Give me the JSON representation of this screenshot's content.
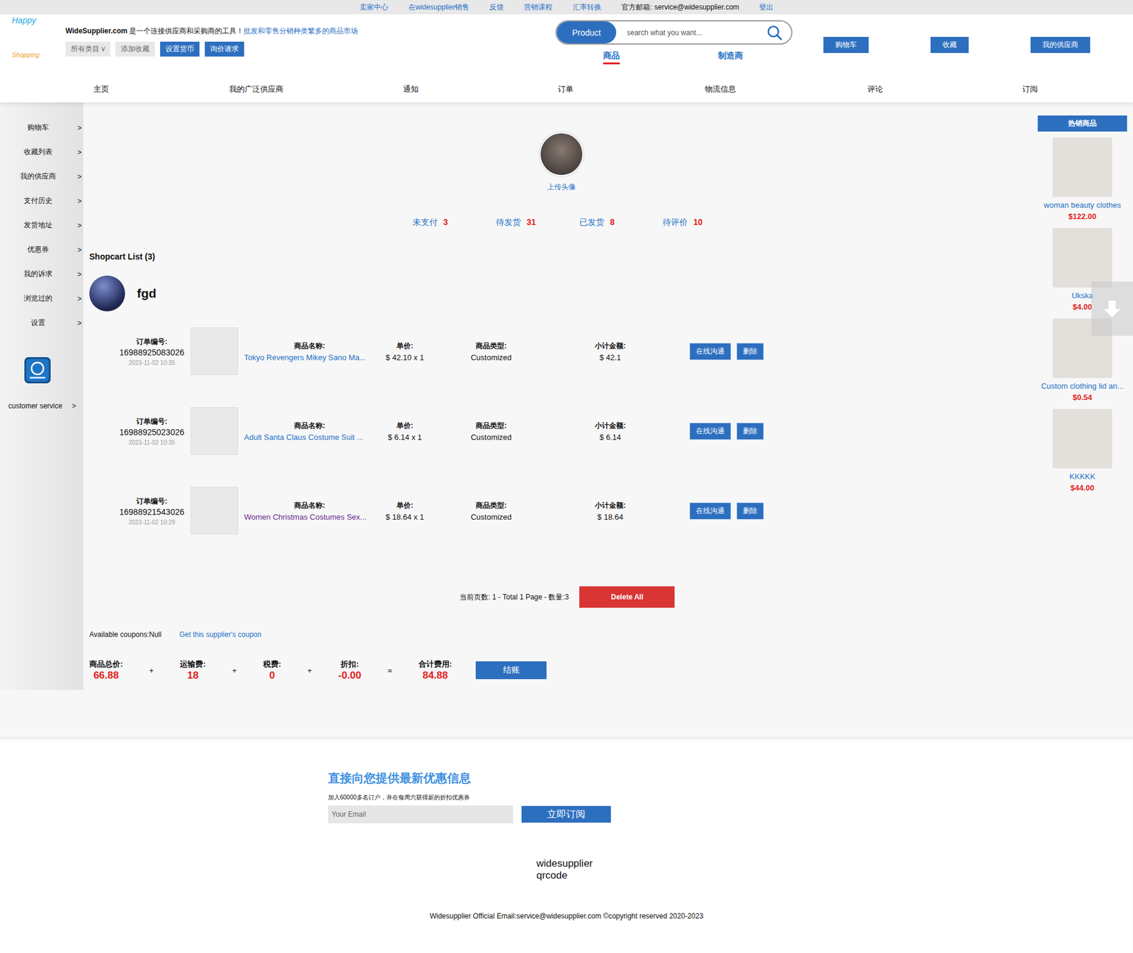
{
  "topbar": {
    "links": [
      {
        "label": "卖家中心",
        "kind": "link"
      },
      {
        "label": "在widesupplier销售",
        "kind": "link"
      },
      {
        "label": "反馈",
        "kind": "link"
      },
      {
        "label": "营销课程",
        "kind": "link"
      },
      {
        "label": "汇率转换",
        "kind": "link"
      },
      {
        "label": "官方邮箱: service@widesupplier.com",
        "kind": "text"
      },
      {
        "label": "登出",
        "kind": "link"
      }
    ]
  },
  "header": {
    "logo": {
      "line1": "Happy",
      "line2": "Shopping"
    },
    "site": "WideSupplier.com",
    "tagline": " 是一个连接供应商和采购商的工具！",
    "slogan": "批发和零售分销种类繁多的商品市场",
    "tools": [
      {
        "label": "所有类目 v",
        "kind": "plain"
      },
      {
        "label": "添加收藏",
        "kind": "plain"
      },
      {
        "label": "设置货币",
        "kind": "primary"
      },
      {
        "label": "询价请求",
        "kind": "primary"
      }
    ],
    "search": {
      "scope": "Product",
      "placeholder": "search what you want..."
    },
    "search_tabs": [
      {
        "label": "商品",
        "selected": true
      },
      {
        "label": "制造商",
        "selected": false
      }
    ],
    "buttons": [
      "购物车",
      "收藏",
      "我的供应商"
    ]
  },
  "nav": [
    "主页",
    "我的广泛供应商",
    "通知",
    "订单",
    "物流信息",
    "评论",
    "订阅"
  ],
  "sidebar": {
    "items": [
      {
        "label": "购物车",
        "arrow": ">"
      },
      {
        "label": "收藏列表",
        "arrow": ">"
      },
      {
        "label": "我的供应商",
        "arrow": ">"
      },
      {
        "label": "支付历史",
        "arrow": ">"
      },
      {
        "label": "发货地址",
        "arrow": ">"
      },
      {
        "label": "优惠券",
        "arrow": ">"
      },
      {
        "label": "我的诉求",
        "arrow": ">"
      },
      {
        "label": "浏览过的",
        "arrow": ">"
      },
      {
        "label": "设置",
        "arrow": ">"
      }
    ],
    "service": {
      "label": "customer service",
      "arrow": ">"
    }
  },
  "profile": {
    "upload": "上传头像",
    "counts": [
      {
        "label": "未支付",
        "count": "3"
      },
      {
        "label": "待发货",
        "count": "31"
      },
      {
        "label": "已发货",
        "count": "8"
      },
      {
        "label": "待评价",
        "count": "10"
      }
    ]
  },
  "cart": {
    "title": "Shopcart List (3)",
    "supplier": "fgd",
    "labels": {
      "order": "订单编号:",
      "name": "商品名称:",
      "price": "单价:",
      "type": "商品类型:",
      "subtotal": "小计金额:"
    },
    "actions": [
      "在线沟通",
      "删除"
    ],
    "items": [
      {
        "order_no": "16988925083026",
        "date": "2023-11-02 10:35",
        "name": "Tokyo Revengers Mikey Sano Ma...",
        "visited": false,
        "price": "$ 42.10 x 1",
        "type": "Customized",
        "subtotal": "$ 42.1"
      },
      {
        "order_no": "16988925023026",
        "date": "2023-11-02 10:35",
        "name": "Adult Santa Claus Costume Suit ...",
        "visited": false,
        "price": "$ 6.14 x 1",
        "type": "Customized",
        "subtotal": "$ 6.14"
      },
      {
        "order_no": "16988921543026",
        "date": "2023-11-02 10:29",
        "name": "Women Christmas Costumes Sex...",
        "visited": true,
        "price": "$ 18.64 x 1",
        "type": "Customized",
        "subtotal": "$ 18.64"
      }
    ]
  },
  "pagination": {
    "info": "当前页数: 1 - Total 1 Page - 数量:3",
    "delete_all": "Delete All"
  },
  "coupons": {
    "label": "Available coupons:Null",
    "link": "Get this supplier's coupon"
  },
  "totals": {
    "terms": [
      {
        "label": "商品总价:",
        "value": "66.88"
      },
      {
        "label": "运输费:",
        "value": "18"
      },
      {
        "label": "税费:",
        "value": "0"
      },
      {
        "label": "折扣:",
        "value": "-0.00"
      },
      {
        "label": "合计费用:",
        "value": "84.88"
      }
    ],
    "operators": [
      "+",
      "+",
      "+",
      "="
    ],
    "checkout": "结账"
  },
  "hot": {
    "title": "热销商品",
    "items": [
      {
        "name": "woman beauty clothes",
        "price": "$122.00"
      },
      {
        "name": "Ukska",
        "price": "$4.00"
      },
      {
        "name": "Custom clothing lid an...",
        "price": "$0.54"
      },
      {
        "name": "KKKKK",
        "price": "$44.00"
      }
    ]
  },
  "footer": {
    "title": "直接向您提供最新优惠信息",
    "subtitle": "加入60000多名订户，并在每周六获得新的折扣优惠券",
    "email_placeholder": "Your Email",
    "subscribe": "立即订阅",
    "qrcode_alt": "widesupplier qrcode",
    "copyright": "Widesupplier Official Email:service@widesupplier.com ©copyright reserved 2020-2023"
  }
}
